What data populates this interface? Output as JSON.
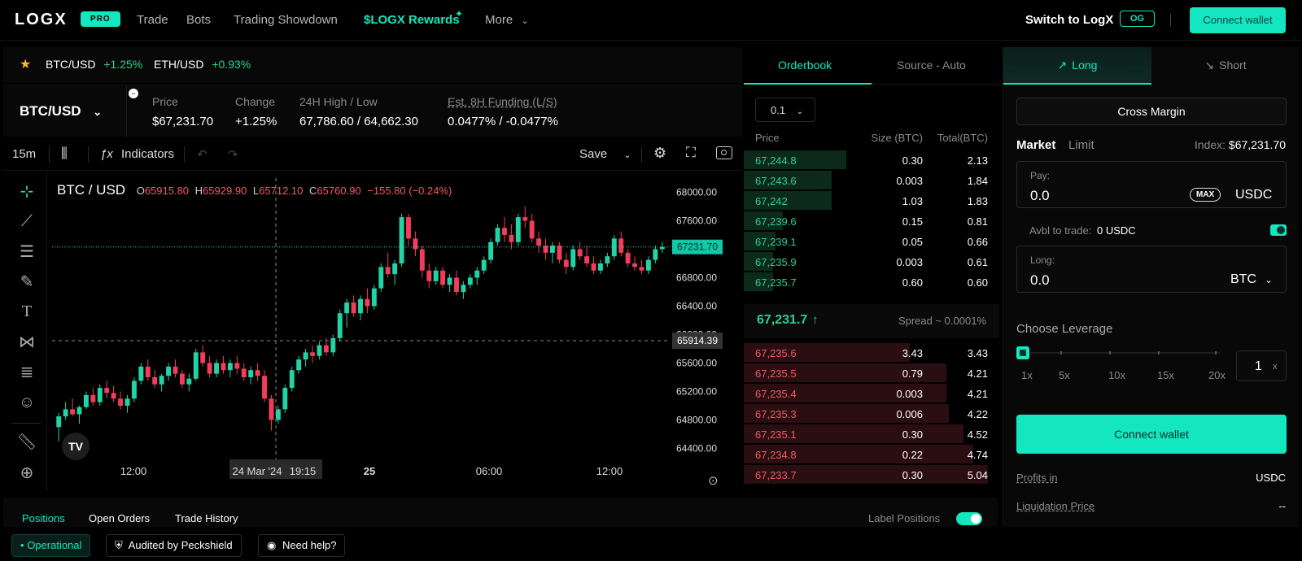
{
  "nav": {
    "logo": "LOGX",
    "pro_badge": "PRO",
    "links": [
      "Trade",
      "Bots",
      "Trading Showdown",
      "$LOGX Rewards",
      "More"
    ],
    "switch_label": "Switch to LogX",
    "og_badge": "OG",
    "connect_wallet": "Connect wallet"
  },
  "tickers": [
    {
      "pair": "BTC/USD",
      "change": "+1.25%"
    },
    {
      "pair": "ETH/USD",
      "change": "+0.93%"
    }
  ],
  "market": {
    "pair": "BTC/USD",
    "stats": [
      {
        "label": "Price",
        "value": "$67,231.70"
      },
      {
        "label": "Change",
        "value": "+1.25%"
      },
      {
        "label": "24H High / Low",
        "value": "67,786.60 / 64,662.30"
      },
      {
        "label": "Est. 8H Funding (L/S)",
        "value": "0.0477% / -0.0477%"
      }
    ]
  },
  "chart_toolbar": {
    "interval": "15m",
    "indicators": "Indicators",
    "save": "Save"
  },
  "chart": {
    "title": "BTC / USD",
    "ohlc": {
      "o": "65915.80",
      "h": "65929.90",
      "l": "65712.10",
      "c": "65760.90",
      "chg": "−155.80 (−0.24%)"
    },
    "price_axis": [
      "68000.00",
      "67600.00",
      "67200.00",
      "66800.00",
      "66400.00",
      "66000.00",
      "65600.00",
      "65200.00",
      "64800.00",
      "64400.00"
    ],
    "time_axis": [
      "12:00",
      "24 Mar '24",
      "19:15",
      "25",
      "06:00",
      "12:00"
    ],
    "last_price_label": "67231.70",
    "crosshair_price_label": "65914.39",
    "colors": {
      "up": "#22d3a6",
      "down": "#f23d5a",
      "accent": "#14e7c0"
    }
  },
  "chart_data": {
    "type": "candlestick",
    "title": "BTC / USD",
    "ylim": [
      64200,
      68200
    ],
    "candles": [
      [
        64700,
        64900,
        64500,
        64850
      ],
      [
        64850,
        65050,
        64800,
        64950
      ],
      [
        64950,
        65100,
        64850,
        64880
      ],
      [
        64880,
        65000,
        64750,
        64980
      ],
      [
        64980,
        65200,
        64950,
        65150
      ],
      [
        65150,
        65250,
        65000,
        65050
      ],
      [
        65050,
        65300,
        65000,
        65250
      ],
      [
        65250,
        65350,
        65100,
        65180
      ],
      [
        65180,
        65280,
        65050,
        65100
      ],
      [
        65100,
        65200,
        64950,
        65000
      ],
      [
        65000,
        65150,
        64900,
        65100
      ],
      [
        65100,
        65400,
        65050,
        65350
      ],
      [
        65350,
        65600,
        65300,
        65550
      ],
      [
        65550,
        65650,
        65350,
        65400
      ],
      [
        65400,
        65500,
        65250,
        65300
      ],
      [
        65300,
        65450,
        65200,
        65420
      ],
      [
        65420,
        65600,
        65350,
        65550
      ],
      [
        65550,
        65650,
        65400,
        65450
      ],
      [
        65450,
        65500,
        65250,
        65300
      ],
      [
        65300,
        65450,
        65200,
        65380
      ],
      [
        65380,
        65800,
        65350,
        65750
      ],
      [
        65750,
        65850,
        65550,
        65600
      ],
      [
        65600,
        65700,
        65400,
        65450
      ],
      [
        65450,
        65650,
        65400,
        65600
      ],
      [
        65600,
        65700,
        65450,
        65500
      ],
      [
        65500,
        65650,
        65400,
        65600
      ],
      [
        65600,
        65700,
        65450,
        65520
      ],
      [
        65520,
        65600,
        65350,
        65400
      ],
      [
        65400,
        65550,
        65300,
        65500
      ],
      [
        65500,
        65600,
        65350,
        65420
      ],
      [
        65420,
        65500,
        65050,
        65100
      ],
      [
        65100,
        65150,
        64650,
        64800
      ],
      [
        64800,
        65000,
        64750,
        64950
      ],
      [
        64950,
        65300,
        64900,
        65250
      ],
      [
        65250,
        65550,
        65200,
        65500
      ],
      [
        65500,
        65700,
        65450,
        65650
      ],
      [
        65650,
        65800,
        65550,
        65750
      ],
      [
        65750,
        65850,
        65600,
        65700
      ],
      [
        65700,
        65900,
        65650,
        65850
      ],
      [
        65850,
        65950,
        65700,
        65750
      ],
      [
        65750,
        66000,
        65700,
        65950
      ],
      [
        65950,
        66350,
        65900,
        66300
      ],
      [
        66300,
        66500,
        66100,
        66450
      ],
      [
        66450,
        66550,
        66250,
        66300
      ],
      [
        66300,
        66550,
        66200,
        66500
      ],
      [
        66500,
        66650,
        66300,
        66400
      ],
      [
        66400,
        66700,
        66350,
        66650
      ],
      [
        66650,
        67000,
        66600,
        66950
      ],
      [
        66950,
        67150,
        66800,
        66850
      ],
      [
        66850,
        67050,
        66700,
        67000
      ],
      [
        67000,
        67700,
        66950,
        67650
      ],
      [
        67650,
        67700,
        67250,
        67350
      ],
      [
        67350,
        67450,
        67100,
        67200
      ],
      [
        67200,
        67250,
        66800,
        66900
      ],
      [
        66900,
        67000,
        66650,
        66750
      ],
      [
        66750,
        66950,
        66700,
        66900
      ],
      [
        66900,
        66950,
        66650,
        66700
      ],
      [
        66700,
        66850,
        66600,
        66800
      ],
      [
        66800,
        66900,
        66550,
        66600
      ],
      [
        66600,
        66750,
        66500,
        66700
      ],
      [
        66700,
        66850,
        66650,
        66800
      ],
      [
        66800,
        66950,
        66700,
        66900
      ],
      [
        66900,
        67100,
        66850,
        67050
      ],
      [
        67050,
        67350,
        67000,
        67300
      ],
      [
        67300,
        67550,
        67250,
        67500
      ],
      [
        67500,
        67650,
        67300,
        67400
      ],
      [
        67400,
        67550,
        67200,
        67300
      ],
      [
        67300,
        67700,
        67250,
        67650
      ],
      [
        67650,
        67800,
        67500,
        67600
      ],
      [
        67600,
        67700,
        67300,
        67350
      ],
      [
        67350,
        67450,
        67150,
        67250
      ],
      [
        67250,
        67350,
        67050,
        67150
      ],
      [
        67150,
        67300,
        67000,
        67250
      ],
      [
        67250,
        67300,
        67000,
        67050
      ],
      [
        67050,
        67150,
        66850,
        66950
      ],
      [
        66950,
        67250,
        66900,
        67200
      ],
      [
        67200,
        67300,
        67050,
        67100
      ],
      [
        67100,
        67250,
        66950,
        67000
      ],
      [
        67000,
        67100,
        66850,
        66900
      ],
      [
        66900,
        67050,
        66850,
        67000
      ],
      [
        67000,
        67150,
        66950,
        67100
      ],
      [
        67100,
        67400,
        67050,
        67350
      ],
      [
        67350,
        67450,
        67100,
        67150
      ],
      [
        67150,
        67200,
        66950,
        67000
      ],
      [
        67000,
        67100,
        66900,
        66950
      ],
      [
        66950,
        67050,
        66850,
        66900
      ],
      [
        66900,
        67100,
        66850,
        67050
      ],
      [
        67050,
        67250,
        67000,
        67200
      ],
      [
        67200,
        67300,
        67150,
        67231.7
      ]
    ]
  },
  "orderbook": {
    "tabs": [
      "Orderbook",
      "Source - Auto"
    ],
    "size_select": "0.1",
    "headers": [
      "Price",
      "Size (BTC)",
      "Total(BTC)"
    ],
    "bids_top": [
      {
        "price": "67,244.8",
        "size": "0.30",
        "total": "2.13",
        "depth": 0.42
      },
      {
        "price": "67,243.6",
        "size": "0.003",
        "total": "1.84",
        "depth": 0.36
      },
      {
        "price": "67,242",
        "size": "1.03",
        "total": "1.83",
        "depth": 0.36
      },
      {
        "price": "67,239.6",
        "size": "0.15",
        "total": "0.81",
        "depth": 0.16
      },
      {
        "price": "67,239.1",
        "size": "0.05",
        "total": "0.66",
        "depth": 0.13
      },
      {
        "price": "67,235.9",
        "size": "0.003",
        "total": "0.61",
        "depth": 0.12
      },
      {
        "price": "67,235.7",
        "size": "0.60",
        "total": "0.60",
        "depth": 0.12
      }
    ],
    "mid_price": "67,231.7",
    "mid_arrow": "↑",
    "spread": "Spread ~ 0.0001%",
    "asks_bottom": [
      {
        "price": "67,235.6",
        "size": "3.43",
        "total": "3.43",
        "depth": 0.68
      },
      {
        "price": "67,235.5",
        "size": "0.79",
        "total": "4.21",
        "depth": 0.83
      },
      {
        "price": "67,235.4",
        "size": "0.003",
        "total": "4.21",
        "depth": 0.83
      },
      {
        "price": "67,235.3",
        "size": "0.006",
        "total": "4.22",
        "depth": 0.84
      },
      {
        "price": "67,235.1",
        "size": "0.30",
        "total": "4.52",
        "depth": 0.9
      },
      {
        "price": "67,234.8",
        "size": "0.22",
        "total": "4.74",
        "depth": 0.94
      },
      {
        "price": "67,233.7",
        "size": "0.30",
        "total": "5.04",
        "depth": 1.0
      }
    ]
  },
  "trade": {
    "long": "Long",
    "short": "Short",
    "margin_mode": "Cross Margin",
    "order_types": [
      "Market",
      "Limit"
    ],
    "index_label": "Index:",
    "index_value": "$67,231.70",
    "pay_label": "Pay:",
    "pay_value": "0.0",
    "max_label": "MAX",
    "pay_token": "USDC",
    "avbl_label": "Avbl to trade:",
    "avbl_value": "0 USDC",
    "long_label": "Long:",
    "long_value": "0.0",
    "long_token": "BTC",
    "leverage_title": "Choose Leverage",
    "leverage_marks": [
      "1x",
      "5x",
      "10x",
      "15x",
      "20x"
    ],
    "leverage_value": "1",
    "leverage_unit": "x",
    "leverage_level": 0,
    "connect_wallet": "Connect wallet",
    "profits_label": "Profits in",
    "profits_value": "USDC",
    "liq_label": "Liquidation Price",
    "liq_value": "--"
  },
  "bottom": {
    "tabs": [
      "Positions",
      "Open Orders",
      "Trade History"
    ],
    "label_positions": "Label Positions"
  },
  "status": {
    "operational": "Operational",
    "audited": "Audited by Peckshield",
    "help": "Need help?"
  }
}
